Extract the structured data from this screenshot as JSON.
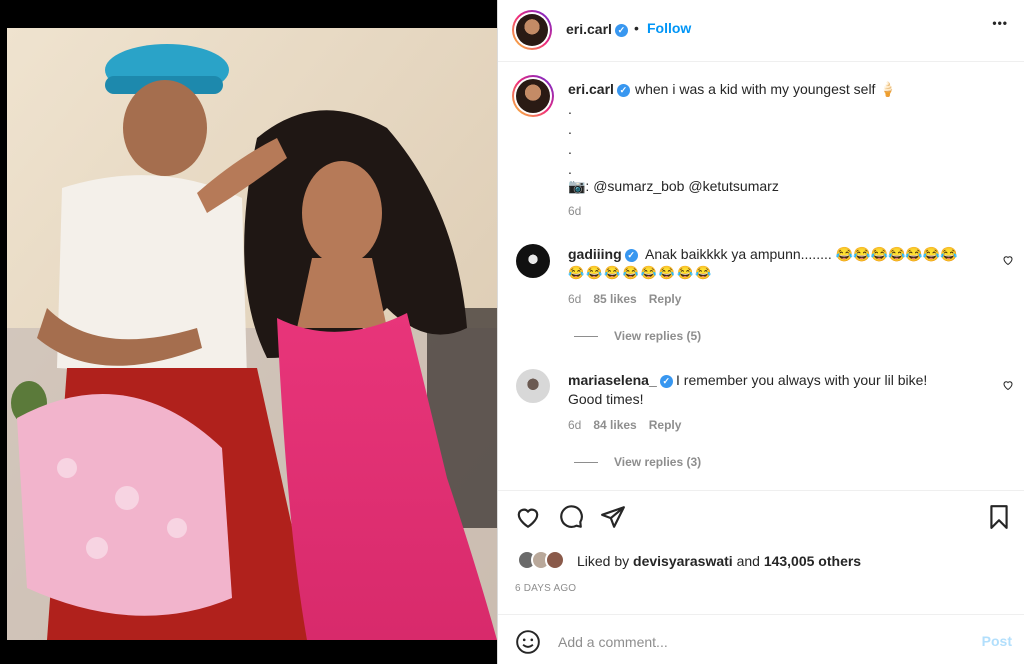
{
  "post": {
    "author": "eri.carl",
    "follow_label": "Follow",
    "separator": "•",
    "more_label": "•••"
  },
  "caption": {
    "author": "eri.carl",
    "text": "when i was a kid with my youngest self 🍦",
    "dots": [
      ".",
      ".",
      ".",
      "."
    ],
    "credit": "📷: @sumarz_bob @ketutsumarz",
    "time": "6d"
  },
  "comments": [
    {
      "user": "gadiiing",
      "text_line1": "Anak baikkkk ya ampunn........ 😂😂😂😂😂😂😂",
      "text_line2": "😂😂😂😂😂😂😂😂",
      "time": "6d",
      "likes": "85 likes",
      "reply": "Reply",
      "view_replies": "View replies (5)"
    },
    {
      "user": "mariaselena_",
      "text_line1": "I remember you always with your lil bike!",
      "text_line2": "Good times!",
      "time": "6d",
      "likes": "84 likes",
      "reply": "Reply",
      "view_replies": "View replies (3)"
    }
  ],
  "actions": {
    "like_icon": "heart-icon",
    "comment_icon": "comment-icon",
    "share_icon": "share-icon",
    "save_icon": "bookmark-icon"
  },
  "likes": {
    "prefix": "Liked by",
    "user": "devisyaraswati",
    "middle": "and",
    "count": "143,005 others"
  },
  "timestamp": "6 DAYS AGO",
  "add_comment": {
    "placeholder": "Add a comment...",
    "post_label": "Post",
    "emoji_icon": "smiley-icon"
  },
  "colors": {
    "accent": "#0095f6",
    "verified": "#3897f0",
    "muted": "#8e8e8e"
  }
}
